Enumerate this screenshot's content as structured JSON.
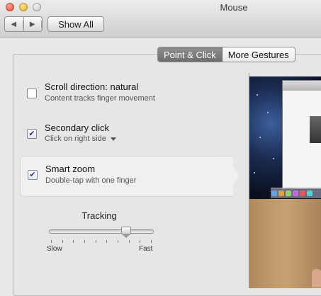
{
  "window": {
    "title": "Mouse"
  },
  "toolbar": {
    "back_glyph": "◀",
    "forward_glyph": "▶",
    "show_all": "Show All"
  },
  "tabs": [
    {
      "label": "Point & Click",
      "active": true
    },
    {
      "label": "More Gestures",
      "active": false
    }
  ],
  "options": [
    {
      "title": "Scroll direction: natural",
      "subtitle": "Content tracks finger movement",
      "checked": false
    },
    {
      "title": "Secondary click",
      "subtitle": "Click on right side",
      "checked": true,
      "has_dropdown": true
    },
    {
      "title": "Smart zoom",
      "subtitle": "Double-tap with one finger",
      "checked": true,
      "selected": true
    }
  ],
  "tracking": {
    "label": "Tracking",
    "min_label": "Slow",
    "max_label": "Fast",
    "value_fraction": 0.75,
    "tick_count": 10
  },
  "check_glyph": "✔"
}
